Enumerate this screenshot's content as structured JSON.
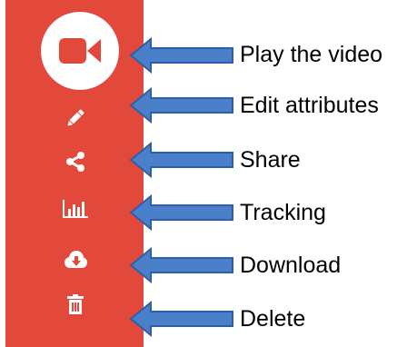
{
  "colors": {
    "sidebar_bg": "#e2493b",
    "icon_color": "#ffffff",
    "arrow_fill": "#4a7fc9",
    "arrow_stroke": "#2e5ea8"
  },
  "actions": [
    {
      "icon": "video-camera-icon",
      "label": "Play the video"
    },
    {
      "icon": "pencil-icon",
      "label": "Edit attributes"
    },
    {
      "icon": "share-icon",
      "label": "Share"
    },
    {
      "icon": "bar-chart-icon",
      "label": "Tracking"
    },
    {
      "icon": "cloud-download-icon",
      "label": "Download"
    },
    {
      "icon": "trash-icon",
      "label": "Delete"
    }
  ]
}
